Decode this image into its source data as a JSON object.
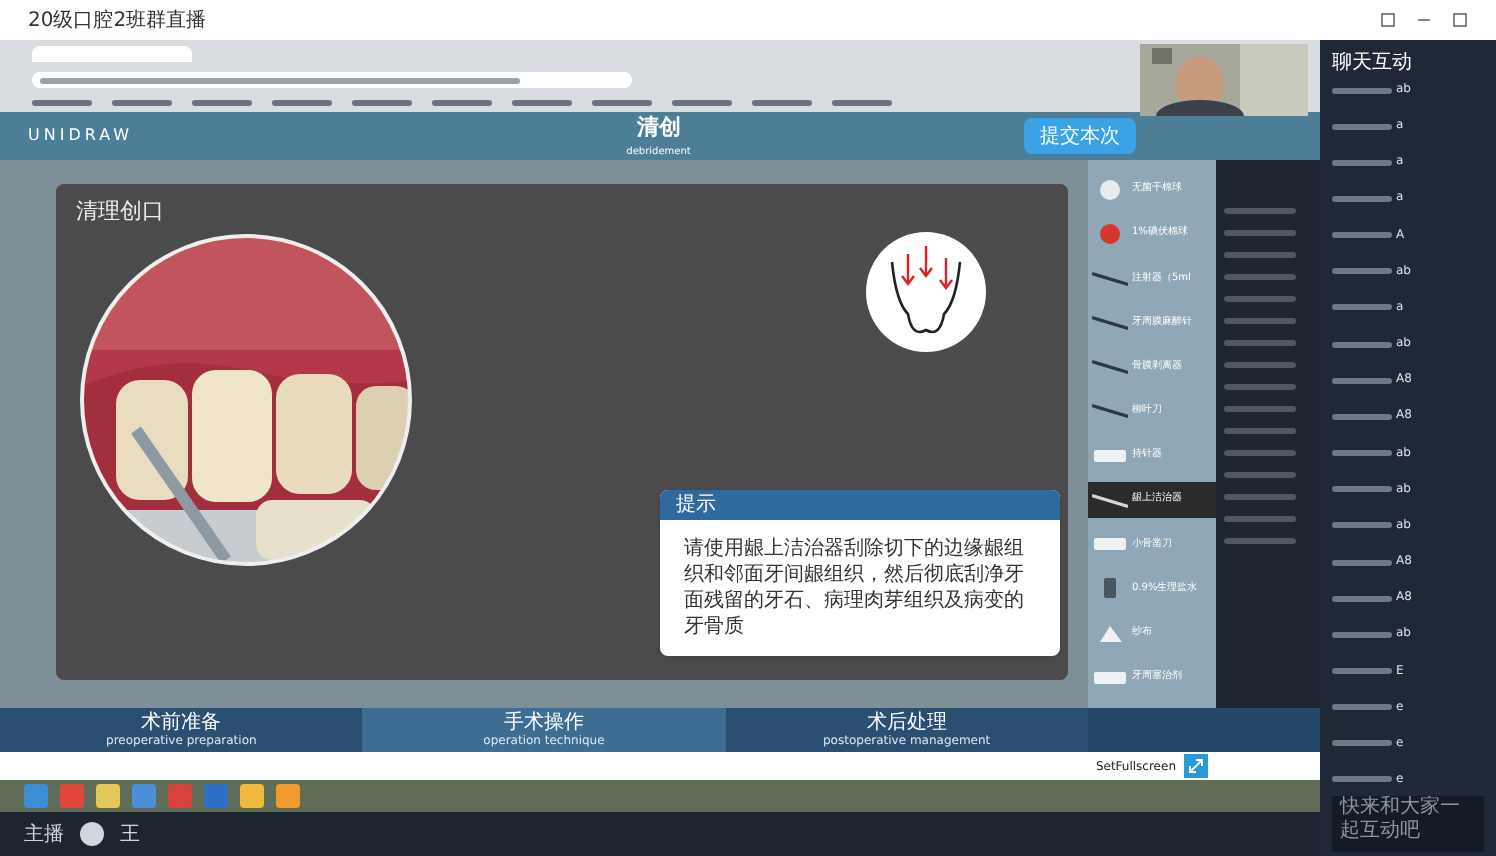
{
  "window": {
    "title": "20级口腔2班群直播"
  },
  "app": {
    "logo": "UNIDRAW",
    "title": "清创",
    "subtitle": "debridement",
    "submit_button": "提交本次",
    "panel_title": "清理创口",
    "tip": {
      "title": "提示",
      "text": "请使用龈上洁治器刮除切下的边缘龈组织和邻面牙间龈组织，然后彻底刮净牙面残留的牙石、病理肉芽组织及病变的牙骨质"
    },
    "tools": [
      {
        "label": "无菌干棉球",
        "selected": false
      },
      {
        "label": "1%碘伏棉球",
        "selected": false
      },
      {
        "label": "注射器（5ml",
        "selected": false
      },
      {
        "label": "牙周膜麻醉针",
        "selected": false
      },
      {
        "label": "骨膜剥离器",
        "selected": false
      },
      {
        "label": "柳叶刀",
        "selected": false
      },
      {
        "label": "持针器",
        "selected": false
      },
      {
        "label": "龈上洁治器",
        "selected": true
      },
      {
        "label": "小骨凿刀",
        "selected": false
      },
      {
        "label": "0.9%生理盐水",
        "selected": false
      },
      {
        "label": "纱布",
        "selected": false
      },
      {
        "label": "牙周塞治剂",
        "selected": false
      }
    ],
    "stages": [
      {
        "title": "术前准备",
        "subtitle": "preoperative preparation",
        "selected": false
      },
      {
        "title": "手术操作",
        "subtitle": "operation technique",
        "selected": true
      },
      {
        "title": "术后处理",
        "subtitle": "postoperative management",
        "selected": false
      }
    ],
    "fullscreen_label": "SetFullscreen"
  },
  "chat": {
    "title": "聊天互动",
    "messages": [
      {
        "text": "ab"
      },
      {
        "text": "a"
      },
      {
        "text": "a"
      },
      {
        "text": "a"
      },
      {
        "text": "A"
      },
      {
        "text": "ab"
      },
      {
        "text": "a"
      },
      {
        "text": "ab"
      },
      {
        "text": "A8"
      },
      {
        "text": "A8"
      },
      {
        "text": "ab"
      },
      {
        "text": "ab"
      },
      {
        "text": "ab"
      },
      {
        "text": "A8"
      },
      {
        "text": "A8"
      },
      {
        "text": "ab"
      },
      {
        "text": "E"
      },
      {
        "text": "e"
      },
      {
        "text": "e"
      },
      {
        "text": "e"
      }
    ],
    "input_placeholder": "快来和大家一起互动吧"
  },
  "host": {
    "role": "主播",
    "name": "王"
  }
}
